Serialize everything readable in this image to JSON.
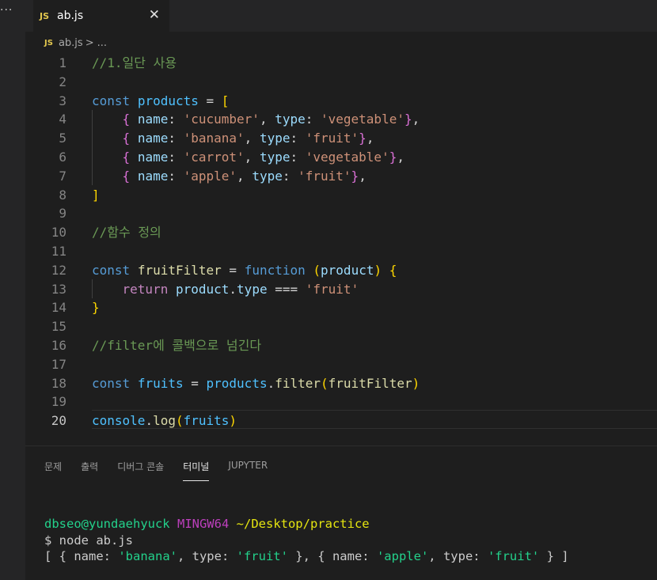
{
  "activity_bar": {
    "more_label": "..."
  },
  "tab": {
    "badge": "JS",
    "filename": "ab.js",
    "close_glyph": "✕"
  },
  "breadcrumb": {
    "badge": "JS",
    "file": "ab.js",
    "separator": ">",
    "ellipsis": "..."
  },
  "code": {
    "line_numbers": [
      "1",
      "2",
      "3",
      "4",
      "5",
      "6",
      "7",
      "8",
      "9",
      "10",
      "11",
      "12",
      "13",
      "14",
      "15",
      "16",
      "17",
      "18",
      "19",
      "20"
    ],
    "active_line": 20,
    "l1_comment": "//1.일단 사용",
    "const": "const",
    "products": "products",
    "eq": " = ",
    "open_bracket": "[",
    "close_bracket": "]",
    "items": [
      {
        "name": "'cucumber'",
        "type": "'vegetable'"
      },
      {
        "name": "'banana'",
        "type": "'fruit'"
      },
      {
        "name": "'carrot'",
        "type": "'vegetable'"
      },
      {
        "name": "'apple'",
        "type": "'fruit'"
      }
    ],
    "name_key": "name",
    "type_key": "type",
    "l10_comment": "//함수 정의",
    "fruitFilter": "fruitFilter",
    "function_kw": "function",
    "product_param": "product",
    "return_kw": "return",
    "product": "product",
    "type_prop": "type",
    "strict_eq": "===",
    "fruit_str": "'fruit'",
    "l16_comment": "//filter에 콜백으로 넘긴다",
    "fruits": "fruits",
    "filter": "filter",
    "console": "console",
    "log": "log"
  },
  "panel": {
    "tabs": [
      "문제",
      "출력",
      "디버그 콘솔",
      "터미널",
      "JUPYTER"
    ],
    "active_tab": "터미널"
  },
  "terminal": {
    "user": "dbseo@yundaehyuck",
    "host": "MINGW64",
    "path": "~/Desktop/practice",
    "command": "$ node ab.js",
    "output": "[ { name: 'banana', type: 'fruit' }, { name: 'apple', type: 'fruit' } ]"
  },
  "colors": {
    "background": "#1e1e1e",
    "comment": "#6a9955",
    "keyword": "#569cd6",
    "string": "#ce9178",
    "terminal_user": "#23d18b",
    "terminal_host": "#bc3fbc",
    "terminal_path": "#e5e510"
  }
}
